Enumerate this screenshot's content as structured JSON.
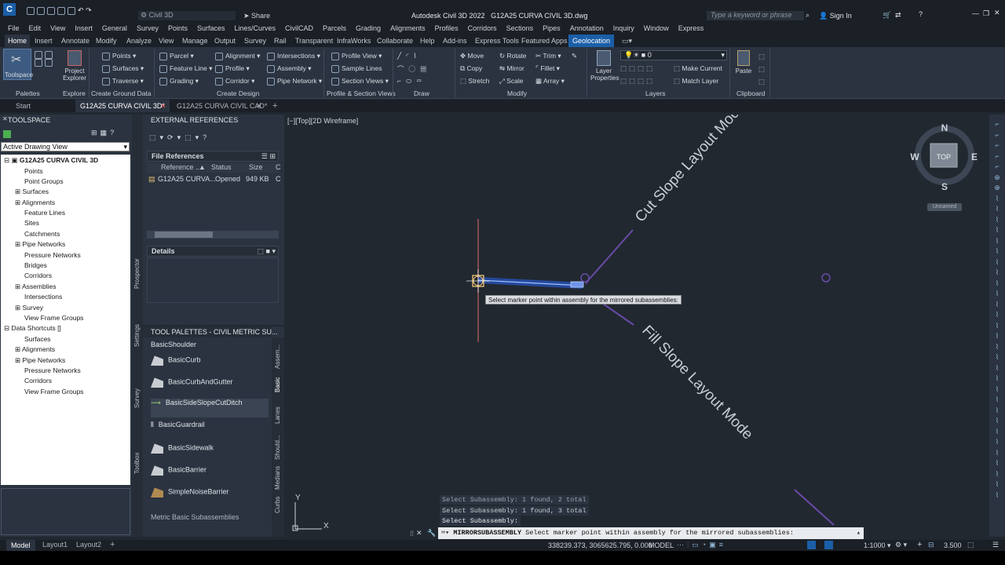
{
  "title_bar": {
    "app_name": "Civil 3D",
    "share": "Share",
    "title": "Autodesk Civil 3D 2022",
    "file": "G12A25 CURVA CIVIL 3D.dwg",
    "search_placeholder": "Type a keyword or phrase",
    "sign_in": "Sign In"
  },
  "menu": [
    "File",
    "Edit",
    "View",
    "Insert",
    "General",
    "Survey",
    "Points",
    "Surfaces",
    "Lines/Curves",
    "CivilCAD",
    "Parcels",
    "Grading",
    "Alignments",
    "Profiles",
    "Corridors",
    "Sections",
    "Pipes",
    "Annotation",
    "Inquiry",
    "Window",
    "Express"
  ],
  "ribbon_tabs": [
    "Home",
    "Insert",
    "Annotate",
    "Modify",
    "Analyze",
    "View",
    "Manage",
    "Output",
    "Survey",
    "Rail",
    "Transparent",
    "InfraWorks",
    "Collaborate",
    "Help",
    "Add-ins",
    "Express Tools",
    "Featured Apps",
    "Geolocation"
  ],
  "ribbon": {
    "toolspace": "Toolspace",
    "project_explorer": "Project Explorer",
    "palettes": "Palettes",
    "explore": "Explore",
    "points": "Points",
    "surfaces": "Surfaces",
    "traverse": "Traverse",
    "create_ground_data": "Create Ground Data",
    "parcel": "Parcel",
    "feature_line": "Feature Line",
    "grading": "Grading",
    "alignment": "Alignment",
    "profile": "Profile",
    "corridor": "Corridor",
    "intersections": "Intersections",
    "assembly": "Assembly",
    "pipe_network": "Pipe Network",
    "create_design": "Create Design",
    "profile_view": "Profile View",
    "sample_lines": "Sample Lines",
    "section_views": "Section Views",
    "profile_section_views": "Profile & Section Views",
    "draw": "Draw",
    "move": "Move",
    "rotate": "Rotate",
    "trim": "Trim",
    "copy": "Copy",
    "mirror": "Mirror",
    "fillet": "Fillet",
    "stretch": "Stretch",
    "scale": "Scale",
    "array": "Array",
    "modify": "Modify",
    "layer_properties": "Layer Properties",
    "layer_value": "0",
    "make_current": "Make Current",
    "match_layer": "Match Layer",
    "layers": "Layers",
    "paste": "Paste",
    "clipboard": "Clipboard"
  },
  "doc_tabs": [
    "Start",
    "G12A25 CURVA CIVIL 3D*",
    "G12A25 CURVA CIVIL CAD*"
  ],
  "toolspace": {
    "header": "TOOLSPACE",
    "view": "Active Drawing View",
    "side_tabs": [
      "Prospector",
      "Settings",
      "Survey",
      "Toolbox"
    ],
    "root": "G12A25 CURVA CIVIL 3D",
    "items": [
      "Points",
      "Point Groups",
      "Surfaces",
      "Alignments",
      "Feature Lines",
      "Sites",
      "Catchments",
      "Pipe Networks",
      "Pressure Networks",
      "Bridges",
      "Corridors",
      "Assemblies",
      "Intersections",
      "Survey",
      "View Frame Groups"
    ],
    "shortcuts_root": "Data Shortcuts []",
    "shortcuts": [
      "Surfaces",
      "Alignments",
      "Pipe Networks",
      "Pressure Networks",
      "Corridors",
      "View Frame Groups"
    ]
  },
  "xref": {
    "header": "EXTERNAL REFERENCES",
    "file_refs": "File References",
    "columns": [
      "Reference ...",
      "Status",
      "Size",
      "C"
    ],
    "row": [
      "G12A25 CURVA...",
      "Opened",
      "949 KB",
      "C"
    ],
    "details": "Details"
  },
  "palette": {
    "header": "TOOL PALETTES - CIVIL METRIC SU...",
    "items": [
      "BasicShoulder",
      "BasicCurb",
      "BasicCurbAndGutter",
      "BasicSideSlopeCutDitch",
      "BasicGuardrail",
      "BasicSidewalk",
      "BasicBarrier",
      "SimpleNoiseBarrier"
    ],
    "footer": "Metric Basic Subassemblies",
    "side_tabs": [
      "Assem...",
      "Basic",
      "Lanes",
      "Should...",
      "Medians",
      "Curbs"
    ]
  },
  "viewport": {
    "label": "[−][Top][2D Wireframe]",
    "cut_text": "Cut Slope Layout Mode",
    "fill_text": "Fill Slope Layout Mode",
    "tooltip": "Select marker point within assembly for the mirrored subassemblies:",
    "compass": {
      "n": "N",
      "s": "S",
      "e": "E",
      "w": "W",
      "top": "TOP"
    },
    "ucs": "Unnamed",
    "axis_x": "X",
    "axis_y": "Y"
  },
  "command": {
    "history": [
      "Select Subassembly: 1 found, 2 total",
      "Select Subassembly: 1 found, 3 total",
      "Select Subassembly:"
    ],
    "name": "MIRRORSUBASSEMBLY",
    "prompt": "Select marker point within assembly for the mirrored subassemblies:"
  },
  "status": {
    "layouts": [
      "Model",
      "Layout1",
      "Layout2"
    ],
    "coords": "338239.373, 3065625.795, 0.000",
    "model": "MODEL",
    "scale": "1:1000",
    "value": "3.500"
  },
  "colors": {
    "accent": "#1b5fa8",
    "bg": "#212830",
    "panel": "#2b3340"
  }
}
